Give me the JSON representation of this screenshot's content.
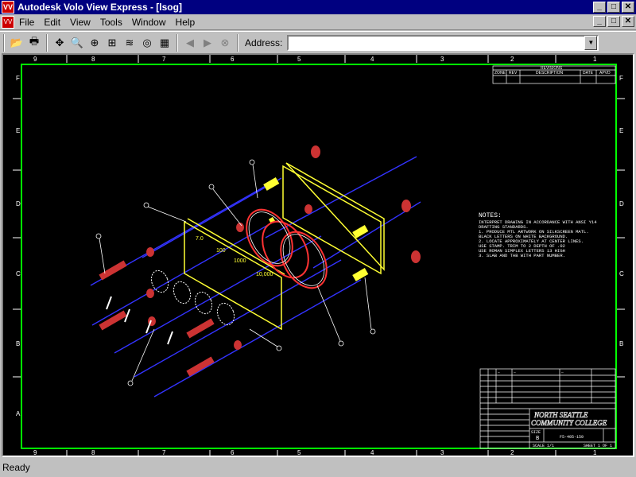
{
  "window": {
    "title": "Autodesk Volo View Express - [lsog]",
    "icon_label": "VV",
    "min": "_",
    "max": "□",
    "close": "✕"
  },
  "menu": [
    "File",
    "Edit",
    "View",
    "Tools",
    "Window",
    "Help"
  ],
  "toolbar": {
    "buttons": [
      "open-icon",
      "print-icon",
      "pan-icon",
      "zoom-realtime-icon",
      "zoom-window-icon",
      "zoom-extents-icon",
      "layers-icon",
      "3d-orbit-icon",
      "grid-icon",
      "back-icon",
      "forward-icon",
      "stop-icon"
    ],
    "address_label": "Address:",
    "address_value": ""
  },
  "drawing": {
    "top_columns": [
      "9",
      "8",
      "7",
      "6",
      "5",
      "4",
      "3",
      "2",
      "1"
    ],
    "side_rows": [
      "F",
      "E",
      "D",
      "C",
      "B",
      "A"
    ],
    "revisions_title": "REVISIONS",
    "revisions_headers": [
      "ZONE",
      "REV",
      "DESCRIPTION",
      "DATE",
      "APVD"
    ],
    "notes": [
      "NOTES:",
      "INTERPRET DRAWING IN ACCORDANCE WITH ANSI Y14",
      "DRAFTING STANDARDS.",
      "1. PRODUCE MTL ARTWORK ON SILKSCREEN MATL.",
      "   BLACK LETTERS ON WHITE BACKGROUND.",
      "2. LOCATE APPROXIMATELY AT CENTER LINES.",
      "   USE STAMP. TRIM TO 2 DEPTH OF .02",
      "   USE ROMAN SIMPLEX LETTERS 13 HIGH",
      "3. SLAB AND TAB WITH PART NUMBER."
    ],
    "plate_labels": [
      "7.0",
      "100",
      "1000",
      "10,000"
    ],
    "school_name": "NORTH SEATTLE",
    "school_sub": "COMMUNITY COLLEGE",
    "size_label": "SIZE",
    "size_value": "B",
    "dwg_no": "F5-405-150",
    "scale": "SCALE  1/1",
    "sheet": "SHEET 1 OF 1"
  },
  "colors": {
    "border": "#00ff00",
    "part_yellow": "#ffff33",
    "part_red": "#ff3333",
    "centerline_blue": "#3333ff",
    "white": "#ffffff"
  },
  "status": "Ready"
}
